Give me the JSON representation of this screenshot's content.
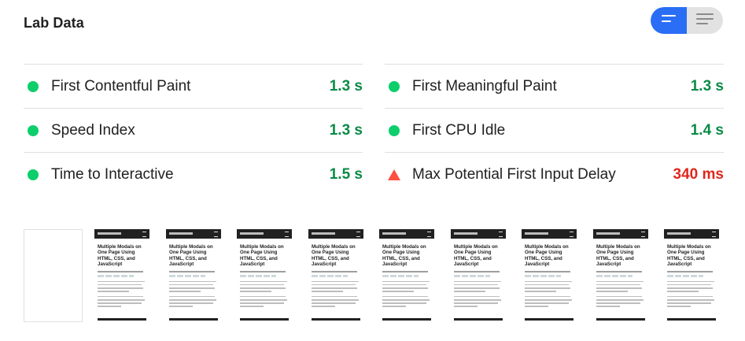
{
  "section": {
    "title": "Lab Data"
  },
  "toggle": {
    "left_icon": "list-compact-icon",
    "right_icon": "list-expanded-icon",
    "active": "left",
    "active_color": "#2a6ef5"
  },
  "metrics": {
    "left": [
      {
        "label": "First Contentful Paint",
        "value": "1.3 s",
        "status": "good"
      },
      {
        "label": "Speed Index",
        "value": "1.3 s",
        "status": "good"
      },
      {
        "label": "Time to Interactive",
        "value": "1.5 s",
        "status": "good"
      }
    ],
    "right": [
      {
        "label": "First Meaningful Paint",
        "value": "1.3 s",
        "status": "good"
      },
      {
        "label": "First CPU Idle",
        "value": "1.4 s",
        "status": "good"
      },
      {
        "label": "Max Potential First Input Delay",
        "value": "340 ms",
        "status": "bad"
      }
    ]
  },
  "colors": {
    "good": "#0cce6b",
    "good_text": "#0a8a47",
    "bad": "#ff4e42",
    "bad_text": "#e0261c"
  },
  "filmstrip": {
    "frames": [
      {
        "blank": true
      },
      {
        "headline": "Multiple Modals on One Page Using HTML, CSS, and JavaScript"
      },
      {
        "headline": "Multiple Modals on One Page Using HTML, CSS, and JavaScript"
      },
      {
        "headline": "Multiple Modals on One Page Using HTML, CSS, and JavaScript"
      },
      {
        "headline": "Multiple Modals on One Page Using HTML, CSS, and JavaScript"
      },
      {
        "headline": "Multiple Modals on One Page Using HTML, CSS, and JavaScript"
      },
      {
        "headline": "Multiple Modals on One Page Using HTML, CSS, and JavaScript"
      },
      {
        "headline": "Multiple Modals on One Page Using HTML, CSS, and JavaScript"
      },
      {
        "headline": "Multiple Modals on One Page Using HTML, CSS, and JavaScript"
      },
      {
        "headline": "Multiple Modals on One Page Using HTML, CSS, and JavaScript"
      }
    ]
  }
}
